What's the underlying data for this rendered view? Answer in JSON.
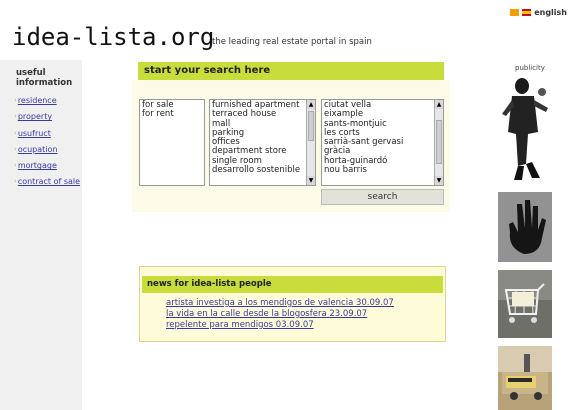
{
  "language": {
    "label": "english"
  },
  "header": {
    "logo": "idea-lista.org",
    "tagline": "the leading real estate portal in spain"
  },
  "sidebar": {
    "title_line1": "useful",
    "title_line2": "information",
    "items": [
      "residence",
      "property",
      "usufruct",
      "ocupation",
      "mortgage",
      "contract of sale"
    ]
  },
  "search": {
    "title": "start your search here",
    "operation_options": [
      "for sale",
      "for rent"
    ],
    "property_types": [
      "furnished apartment",
      "terraced house",
      "mall",
      "parking",
      "offices",
      "department store",
      "single room",
      "desarrollo sostenible"
    ],
    "districts": [
      "ciutat vella",
      "eixample",
      "sants-montjuic",
      "les corts",
      "sarrià-sant gervasi",
      "gràcia",
      "horta-guinardó",
      "nou barris"
    ],
    "button_label": "search"
  },
  "news": {
    "title": "news for idea-lista people",
    "items": [
      "artista investiga a los mendigos de valencia 30.09.07",
      "la vida en la calle desde la blogosfera 23.09.07",
      "repelente para mendigos 03.09.07"
    ]
  },
  "publicity": {
    "label": "publicity"
  }
}
